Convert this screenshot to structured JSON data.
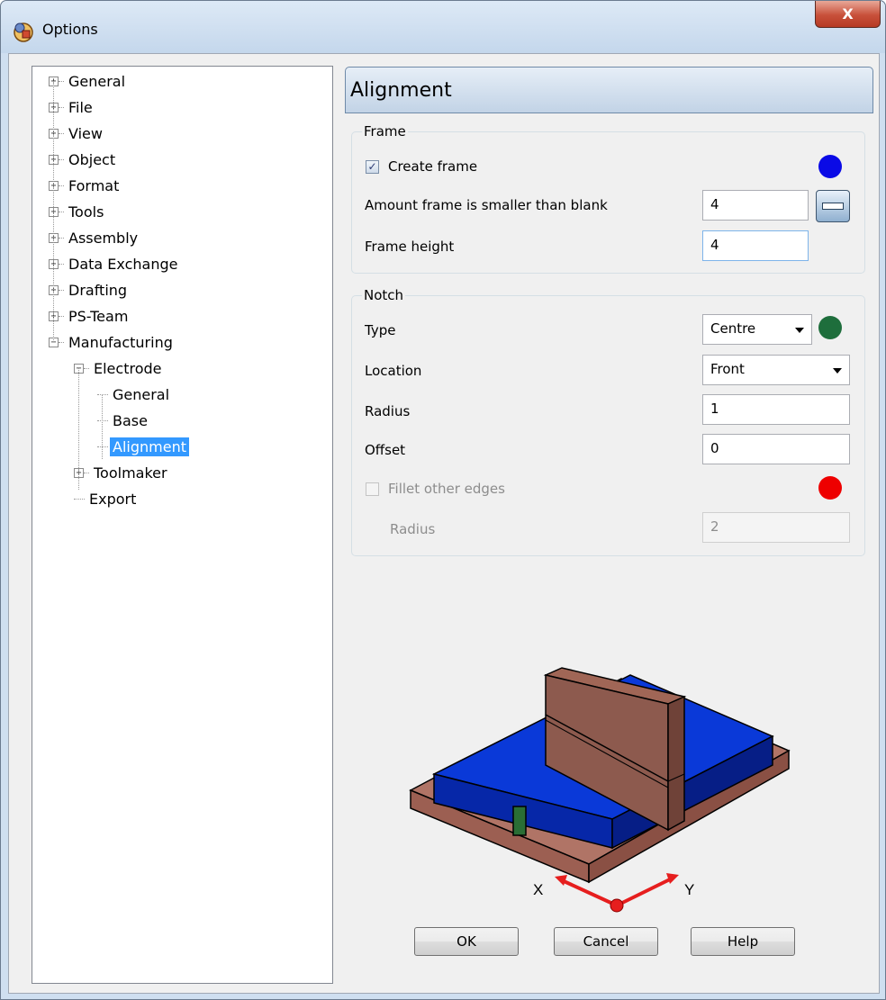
{
  "window": {
    "title": "Options",
    "close_glyph": "X",
    "icon": "options-app-icon"
  },
  "tree": {
    "items": [
      {
        "label": "General",
        "expander": "+",
        "level": 0
      },
      {
        "label": "File",
        "expander": "+",
        "level": 0
      },
      {
        "label": "View",
        "expander": "+",
        "level": 0
      },
      {
        "label": "Object",
        "expander": "+",
        "level": 0
      },
      {
        "label": "Format",
        "expander": "+",
        "level": 0
      },
      {
        "label": "Tools",
        "expander": "+",
        "level": 0
      },
      {
        "label": "Assembly",
        "expander": "+",
        "level": 0
      },
      {
        "label": "Data Exchange",
        "expander": "+",
        "level": 0
      },
      {
        "label": "Drafting",
        "expander": "+",
        "level": 0
      },
      {
        "label": "PS-Team",
        "expander": "+",
        "level": 0
      },
      {
        "label": "Manufacturing",
        "expander": "−",
        "level": 0
      },
      {
        "label": "Electrode",
        "expander": "−",
        "level": 1
      },
      {
        "label": "General",
        "expander": "",
        "level": 2
      },
      {
        "label": "Base",
        "expander": "",
        "level": 2
      },
      {
        "label": "Alignment",
        "expander": "",
        "level": 2,
        "selected": true
      },
      {
        "label": "Toolmaker",
        "expander": "+",
        "level": 1
      },
      {
        "label": "Export",
        "expander": "",
        "level": 1
      }
    ]
  },
  "panel": {
    "title": "Alignment"
  },
  "frame": {
    "group_title": "Frame",
    "create_frame_label": "Create frame",
    "create_frame_checked": true,
    "create_frame_color": "#0a0ae6",
    "smaller_label": "Amount frame is smaller than blank",
    "smaller_value": "4",
    "height_label": "Frame height",
    "height_value": "4"
  },
  "notch": {
    "group_title": "Notch",
    "type_label": "Type",
    "type_value": "Centre",
    "type_color": "#1e6e3c",
    "location_label": "Location",
    "location_value": "Front",
    "radius_label": "Radius",
    "radius_value": "1",
    "offset_label": "Offset",
    "offset_value": "0",
    "fillet_label": "Fillet other edges",
    "fillet_checked": false,
    "fillet_color": "#ee0000",
    "fillet_radius_label": "Radius",
    "fillet_radius_value": "2"
  },
  "preview": {
    "x_axis_label": "X",
    "y_axis_label": "Y",
    "colors": {
      "base": "#a86a5e",
      "frame": "#0a35d0",
      "block": "#8d5a4e",
      "notch": "#2a6e35",
      "axes": "#e61e1e"
    }
  },
  "buttons": {
    "ok": "OK",
    "cancel": "Cancel",
    "help": "Help"
  }
}
